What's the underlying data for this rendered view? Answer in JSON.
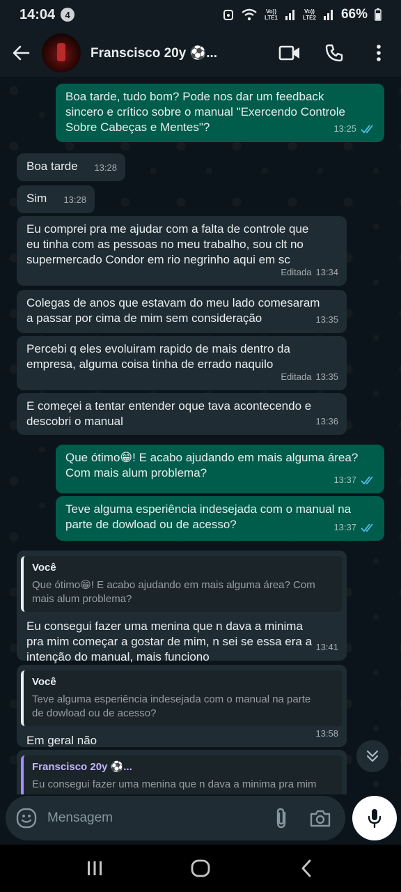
{
  "status_bar": {
    "time": "14:04",
    "notification_count": "4",
    "sim1": "Vo)) LTE1",
    "sim2": "Vo)) LTE2",
    "battery": "66%"
  },
  "header": {
    "contact_name": "Franscisco 20y ⚽..."
  },
  "messages": [
    {
      "direction": "out",
      "text": "Boa tarde, tudo bom? Pode nos dar um feedback\nsincero e crítico sobre o manual \"Exercendo Controle\nSobre Cabeças e Mentes\"?",
      "time": "13:25",
      "status": "read"
    },
    {
      "direction": "in",
      "text": "Boa tarde",
      "time": "13:28"
    },
    {
      "direction": "in",
      "text": "Sim",
      "time": "13:28"
    },
    {
      "direction": "in",
      "text": "Eu comprei pra me ajudar com a falta de controle que\neu tinha com as pessoas no meu trabalho, sou clt no\nsupermercado Condor em rio negrinho aqui em sc",
      "edited": "Editada",
      "time": "13:34"
    },
    {
      "direction": "in",
      "text": "Colegas de anos que estavam do meu lado comesaram\na passar por cima de mim sem consideração",
      "time": "13:35"
    },
    {
      "direction": "in",
      "text": "Percebi q eles evoluiram rapido de mais dentro da\nempresa, alguma coisa tinha de errado naquilo",
      "edited": "Editada",
      "time": "13:35"
    },
    {
      "direction": "in",
      "text": "E começei a tentar entender oque tava acontecendo e\ndescobri o manual",
      "time": "13:36"
    },
    {
      "direction": "out",
      "text": "Que ótimo😁! E acabo ajudando em mais alguma área?\nCom mais alum problema?",
      "time": "13:37",
      "status": "read"
    },
    {
      "direction": "out",
      "text": "Teve alguma esperiência indesejada com o manual na\nparte de dowload ou de acesso?",
      "time": "13:37",
      "status": "read"
    },
    {
      "direction": "in",
      "quote_author": "Você",
      "quote_text": "Que ótimo😁! E acabo ajudando em mais alguma área? Com\nmais alum problema?",
      "text": "Eu consegui fazer uma menina que n dava a minima\npra mim começar a gostar de mim, n sei se essa era a\nintenção do manual, mais funciono",
      "time": "13:41"
    },
    {
      "direction": "in",
      "quote_author": "Você",
      "quote_text": "Teve alguma esperiência indesejada com o manual na parte\nde dowload ou de acesso?",
      "text": "Em geral não",
      "time": "13:58"
    },
    {
      "direction": "in",
      "quote_author": "Franscisco 20y ⚽...",
      "quote_text": "Eu consegui fazer uma menina que n dava a minima pra mim"
    }
  ],
  "composer": {
    "placeholder": "Mensagem"
  },
  "colors": {
    "incoming_bubble": "#202c33",
    "outgoing_bubble": "#005c4b",
    "read_ticks": "#53bdeb",
    "background": "#0b141a"
  },
  "icons": [
    "back-arrow-icon",
    "video-call-icon",
    "phone-icon",
    "more-vert-icon",
    "emoji-icon",
    "attach-icon",
    "camera-icon",
    "mic-icon",
    "double-chevron-down-icon",
    "double-check-icon"
  ]
}
